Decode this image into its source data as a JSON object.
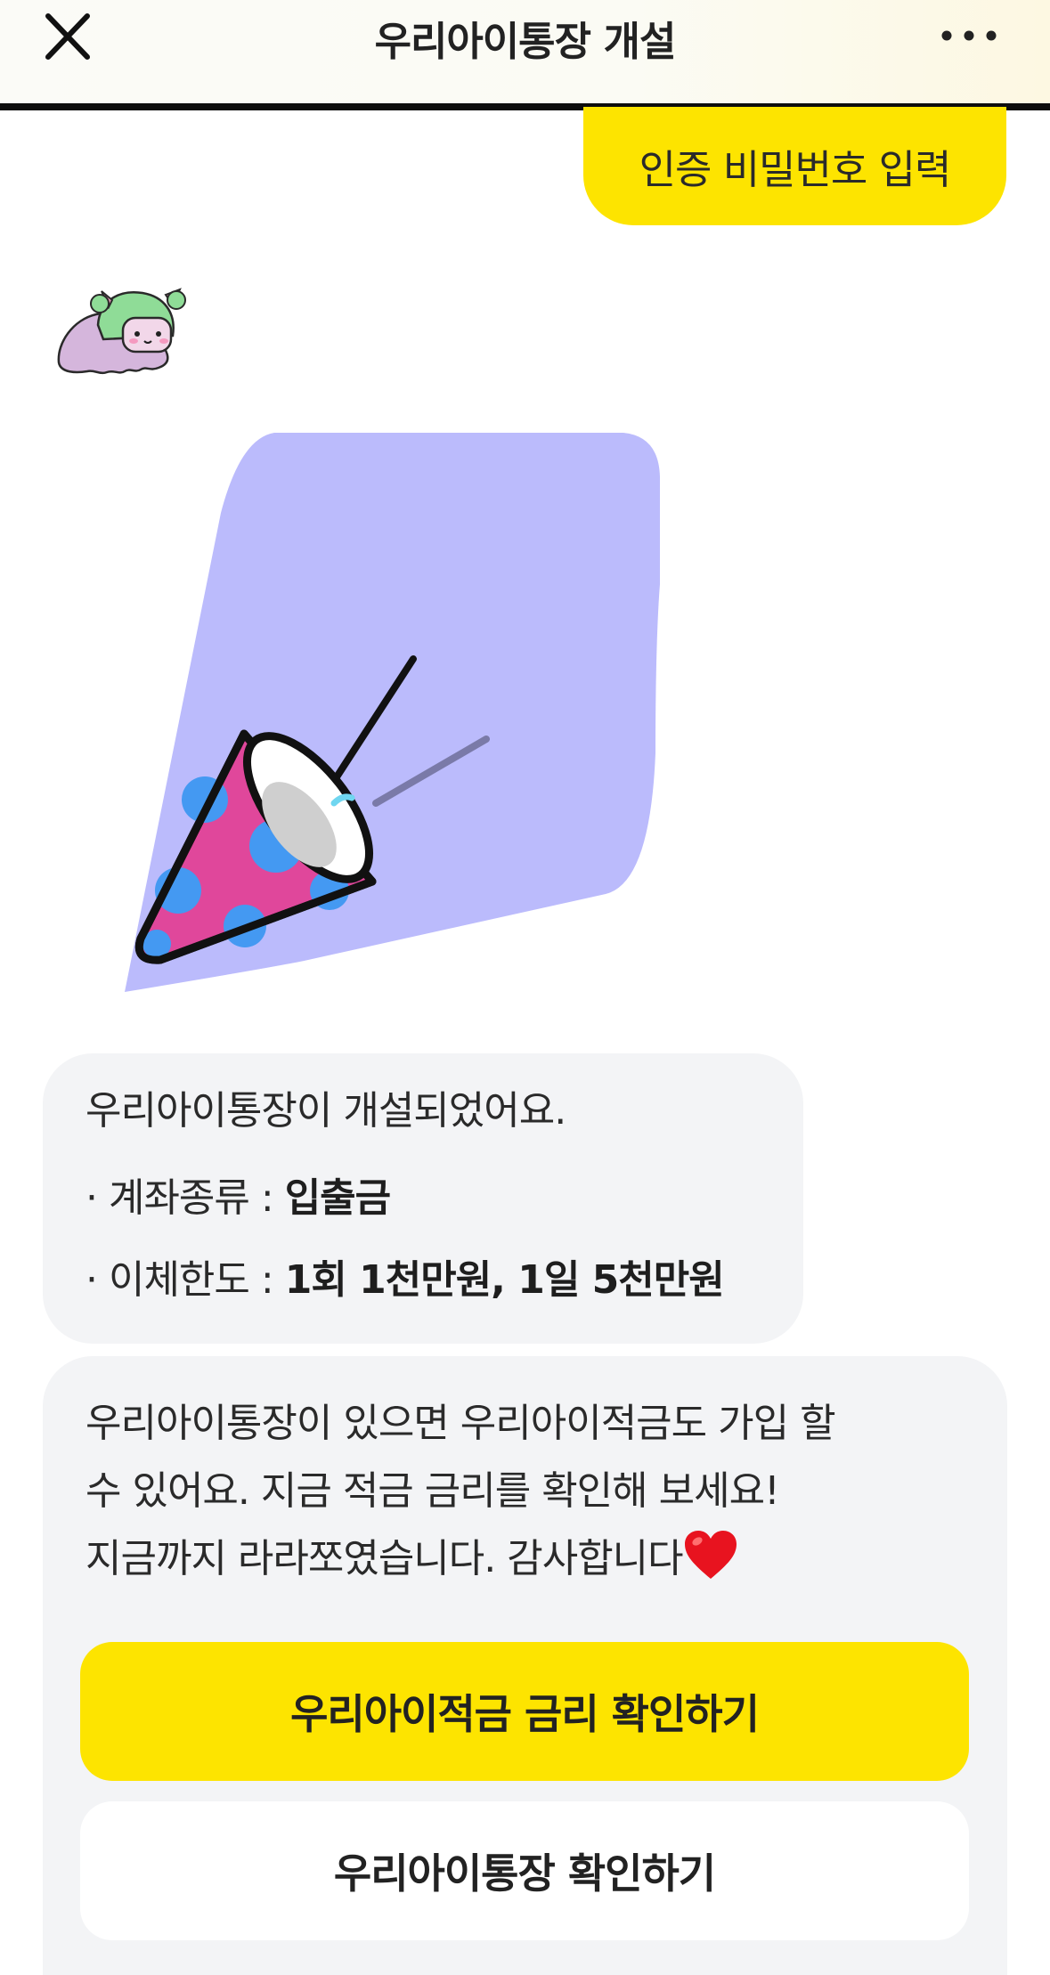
{
  "header": {
    "title": "우리아이통장 개설",
    "close_icon": "close-icon",
    "more_icon": "more-horizontal-icon"
  },
  "user_reply": {
    "text": "인증 비밀번호 입력"
  },
  "avatar": {
    "icon": "character-avatar"
  },
  "illustration": {
    "icon": "party-popper-icon"
  },
  "result_message": {
    "title": "우리아이통장이 개설되었어요.",
    "items": [
      {
        "label": "· 계좌종류 : ",
        "value": "입출금"
      },
      {
        "label": "· 이체한도 : ",
        "value": "1회 1천만원, 1일 5천만원"
      }
    ]
  },
  "promo_message": {
    "line1": "우리아이통장이 있으면 우리아이적금도 가입 할",
    "line2": "수 있어요. 지금 적금 금리를 확인해 보세요!",
    "line3": "지금까지 라라쪼였습니다. 감사합니다",
    "heart_icon": "red-heart-icon",
    "primary_button": "우리아이적금 금리 확인하기",
    "secondary_button": "우리아이통장 확인하기"
  },
  "colors": {
    "accent_yellow": "#fde400",
    "bubble_gray": "#f3f4f6",
    "illustration_lavender": "#bbbbfc",
    "cone_pink": "#e0479b",
    "cone_dots": "#4499f2"
  }
}
